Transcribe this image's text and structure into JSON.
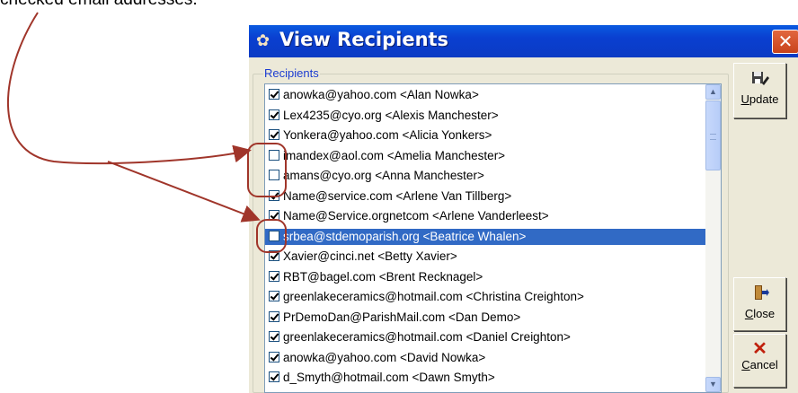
{
  "caption": "checked email addresses.",
  "window": {
    "title": "View Recipients",
    "close_glyph": "✕",
    "group_label": "Recipients"
  },
  "recipients": [
    {
      "text": "anowka@yahoo.com <Alan Nowka>",
      "checked": true,
      "selected": false
    },
    {
      "text": "Lex4235@cyo.org <Alexis Manchester>",
      "checked": true,
      "selected": false
    },
    {
      "text": "Yonkera@yahoo.com <Alicia Yonkers>",
      "checked": true,
      "selected": false
    },
    {
      "text": "imandex@aol.com <Amelia Manchester>",
      "checked": false,
      "selected": false
    },
    {
      "text": "amans@cyo.org <Anna Manchester>",
      "checked": false,
      "selected": false
    },
    {
      "text": "Name@service.com <Arlene Van Tillberg>",
      "checked": true,
      "selected": false
    },
    {
      "text": "Name@Service.orgnetcom <Arlene Vanderleest>",
      "checked": true,
      "selected": false
    },
    {
      "text": "srbea@stdemoparish.org <Beatrice Whalen>",
      "checked": false,
      "selected": true
    },
    {
      "text": "Xavier@cinci.net <Betty Xavier>",
      "checked": true,
      "selected": false
    },
    {
      "text": "RBT@bagel.com <Brent Recknagel>",
      "checked": true,
      "selected": false
    },
    {
      "text": "greenlakeceramics@hotmail.com <Christina Creighton>",
      "checked": true,
      "selected": false
    },
    {
      "text": "PrDemoDan@ParishMail.com <Dan Demo>",
      "checked": true,
      "selected": false
    },
    {
      "text": "greenlakeceramics@hotmail.com <Daniel Creighton>",
      "checked": true,
      "selected": false
    },
    {
      "text": "anowka@yahoo.com <David Nowka>",
      "checked": true,
      "selected": false
    },
    {
      "text": "d_Smyth@hotmail.com <Dawn Smyth>",
      "checked": true,
      "selected": false
    }
  ],
  "buttons": {
    "update": {
      "mnemonic": "U",
      "rest": "pdate",
      "icon": "floppy-pencil-icon"
    },
    "close": {
      "mnemonic": "C",
      "rest": "lose",
      "icon": "exit-door-icon"
    },
    "cancel": {
      "mnemonic": "C",
      "rest": "ancel",
      "icon": "red-x-icon"
    }
  },
  "colors": {
    "title_bar": "#0a4bd6",
    "selection": "#316ac5",
    "annotation": "#a0352a",
    "cancel_x": "#c0200c"
  }
}
